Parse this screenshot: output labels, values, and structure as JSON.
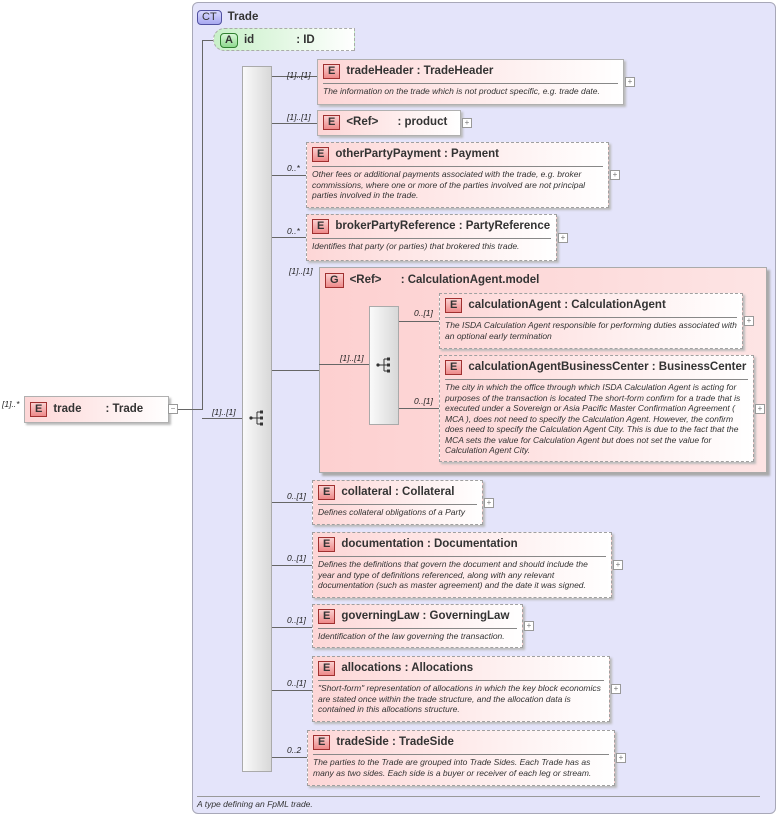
{
  "complex_type": {
    "badge": "CT",
    "name": "Trade",
    "documentation": "A type defining an FpML trade."
  },
  "attribute": {
    "badge": "A",
    "name": "id",
    "type": ": ID"
  },
  "root": {
    "badge": "E",
    "name": "trade",
    "type": ": Trade",
    "multiplicity": "[1]..*",
    "collapse": "−"
  },
  "sequence_multiplicity": "[1]..[1]",
  "children": [
    {
      "badge": "E",
      "title": "tradeHeader : TradeHeader",
      "multiplicity": "[1]..[1]",
      "doc": "The information on the trade which is not product specific, e.g. trade date.",
      "optional": false
    },
    {
      "badge": "E",
      "title": "<Ref>      : product",
      "multiplicity": "[1]..[1]",
      "doc": "",
      "optional": false
    },
    {
      "badge": "E",
      "title": "otherPartyPayment : Payment",
      "multiplicity": "0..*",
      "doc": "Other fees or additional payments associated with the trade, e.g. broker commissions, where one or more of the parties involved are not principal parties involved in the trade.",
      "optional": true
    },
    {
      "badge": "E",
      "title": "brokerPartyReference : PartyReference",
      "multiplicity": "0..*",
      "doc": "Identifies that party (or parties) that brokered this trade.",
      "optional": true
    },
    {
      "badge": "E",
      "title": "collateral : Collateral",
      "multiplicity": "0..[1]",
      "doc": "Defines collateral obligations of a Party",
      "optional": true
    },
    {
      "badge": "E",
      "title": "documentation : Documentation",
      "multiplicity": "0..[1]",
      "doc": "Defines the definitions that govern the document and should include the year and type of definitions referenced, along with any relevant documentation (such as master agreement) and the date it was signed.",
      "optional": true
    },
    {
      "badge": "E",
      "title": "governingLaw : GoverningLaw",
      "multiplicity": "0..[1]",
      "doc": "Identification of the law governing the transaction.",
      "optional": true
    },
    {
      "badge": "E",
      "title": "allocations : Allocations",
      "multiplicity": "0..[1]",
      "doc": "\"Short-form\" representation of allocations in which the key block economics are stated once within the trade structure, and the allocation data is contained in this allocations structure.",
      "optional": true
    },
    {
      "badge": "E",
      "title": "tradeSide : TradeSide",
      "multiplicity": "0..2",
      "doc": "The parties to the Trade are grouped into Trade Sides. Each Trade has as many as two sides. Each side is a buyer or receiver of each leg or stream.",
      "optional": true
    }
  ],
  "group": {
    "badge": "G",
    "title": "<Ref>      : CalculationAgent.model",
    "multiplicity": "[1]..[1]",
    "sequence_multiplicity": "[1]..[1]",
    "children": [
      {
        "badge": "E",
        "title": "calculationAgent : CalculationAgent",
        "multiplicity": "0..[1]",
        "doc": "The ISDA Calculation Agent responsible for performing duties associated with an optional early termination",
        "optional": true
      },
      {
        "badge": "E",
        "title": "calculationAgentBusinessCenter : BusinessCenter",
        "multiplicity": "0..[1]",
        "doc": "The city in which the office through which ISDA Calculation Agent is acting for purposes of the transaction is located The short-form confirm for a trade that is executed under a Sovereign or Asia Pacific Master Confirmation Agreement ( MCA ), does not need to specify the Calculation Agent. However, the confirm does need to specify the Calculation Agent City. This is due to the fact that the MCA sets the value for Calculation Agent but does not set the value for Calculation Agent City.",
        "optional": true
      }
    ]
  },
  "expand_symbol": "+",
  "colors": {
    "element": "#fdd6d6",
    "attribute": "#d8f8d8",
    "complex_type_bg": "#e4e4fa"
  }
}
